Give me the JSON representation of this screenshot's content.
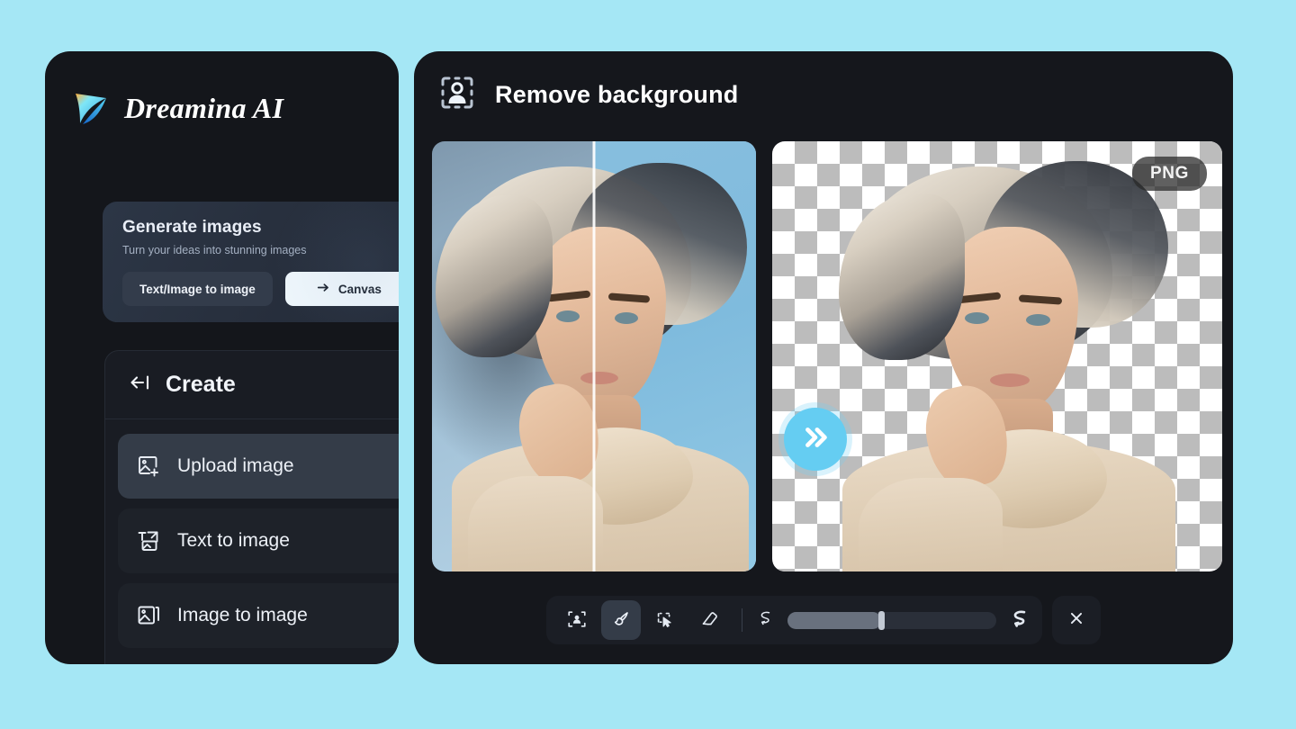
{
  "theme": {
    "page_background": "#a5e7f5",
    "panel_background": "#15171c",
    "accent_blue": "#65cdf2",
    "active_tool_background": "#343c48"
  },
  "sidebar": {
    "brand": {
      "name": "Dreamina AI",
      "logo_icon": "dreamina-star-logo"
    },
    "generate_card": {
      "title": "Generate images",
      "subtitle": "Turn your ideas into stunning images",
      "primary_button": "Text/Image to image",
      "secondary_button": "Canvas",
      "secondary_button_icon": "arrow-right-icon"
    },
    "create_section": {
      "header_label": "Create",
      "header_icon": "collapse-panel-icon",
      "items": [
        {
          "label": "Upload image",
          "icon": "image-plus-icon",
          "active": true
        },
        {
          "label": "Text to image",
          "icon": "text-to-image-icon",
          "active": false
        },
        {
          "label": "Image to image",
          "icon": "image-stack-icon",
          "active": false
        }
      ]
    }
  },
  "main": {
    "header": {
      "title": "Remove background",
      "icon": "person-cutout-icon"
    },
    "preview": {
      "before_after_label": "before-after-comparison",
      "transition_icon": "double-chevron-right-icon",
      "result_badge": "PNG",
      "result_background": "transparent-checkerboard"
    },
    "toolbar": {
      "tools": [
        {
          "name": "auto-select-subject",
          "icon": "person-frame-icon",
          "active": false
        },
        {
          "name": "brush",
          "icon": "paintbrush-icon",
          "active": true
        },
        {
          "name": "lasso-select",
          "icon": "marquee-cursor-icon",
          "active": false
        },
        {
          "name": "eraser",
          "icon": "eraser-icon",
          "active": false
        }
      ],
      "brush_size": {
        "small_icon": "small-stroke-icon",
        "large_icon": "large-stroke-icon",
        "value_percent": 45
      },
      "close_button_icon": "close-x-icon"
    }
  }
}
